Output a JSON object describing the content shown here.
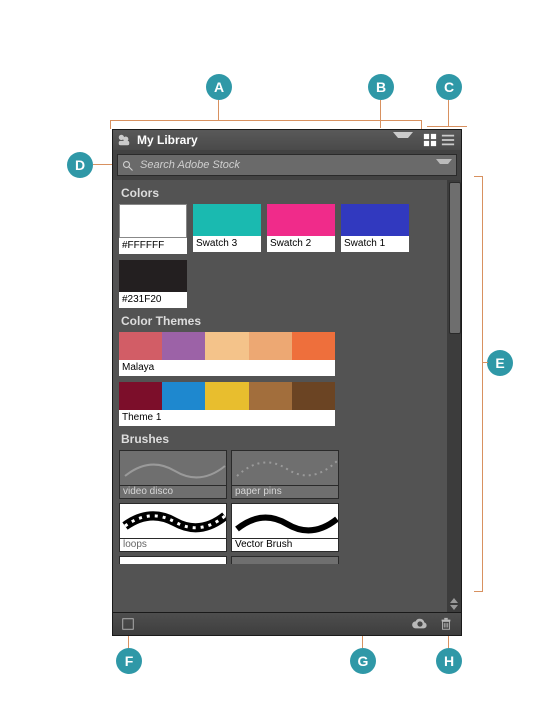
{
  "header": {
    "title": "My Library",
    "grid_view_icon": "grid-view-icon",
    "list_view_icon": "list-view-icon"
  },
  "search": {
    "placeholder": "Search Adobe Stock",
    "value": ""
  },
  "sections": {
    "colors": {
      "title": "Colors",
      "swatches": [
        {
          "color": "#FFFFFF",
          "label": "#FFFFFF"
        },
        {
          "color": "#1ABAB0",
          "label": "Swatch 3"
        },
        {
          "color": "#F02B8A",
          "label": "Swatch 2"
        },
        {
          "color": "#3139BF",
          "label": "Swatch 1"
        },
        {
          "color": "#231F20",
          "label": "#231F20"
        }
      ]
    },
    "color_themes": {
      "title": "Color Themes",
      "themes": [
        {
          "label": "Malaya",
          "colors": [
            "#D25D66",
            "#9C62A7",
            "#F4C38A",
            "#EDA873",
            "#EE6F3C"
          ]
        },
        {
          "label": "Theme 1",
          "colors": [
            "#7C0E2A",
            "#1E88CF",
            "#E8BE2E",
            "#A26E3C",
            "#6B4423"
          ]
        }
      ]
    },
    "brushes": {
      "title": "Brushes",
      "items": [
        {
          "label": "video disco",
          "style": "gray"
        },
        {
          "label": "paper pins",
          "style": "gray"
        },
        {
          "label": "loops",
          "style": "white-pattern"
        },
        {
          "label": "Vector Brush",
          "style": "white-black"
        }
      ]
    }
  },
  "callouts": {
    "A": "A",
    "B": "B",
    "C": "C",
    "D": "D",
    "E": "E",
    "F": "F",
    "G": "G",
    "H": "H"
  }
}
